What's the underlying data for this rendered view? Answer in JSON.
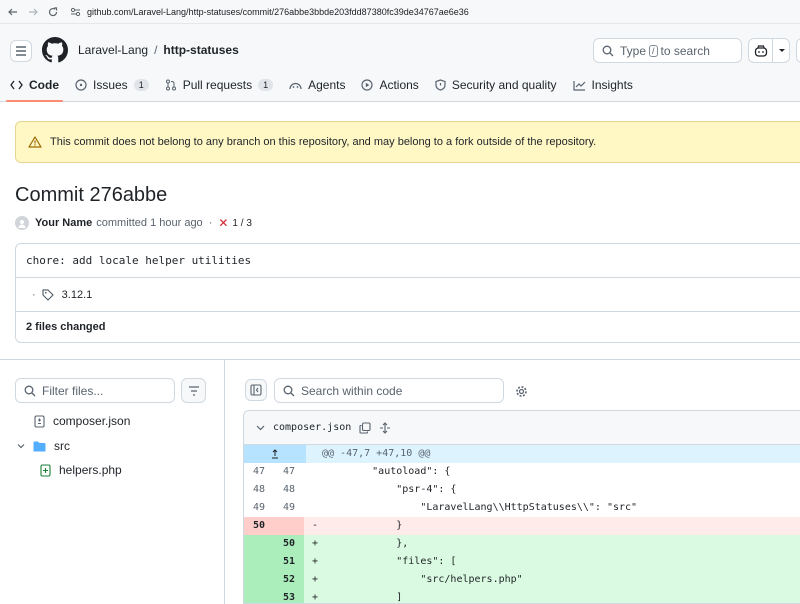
{
  "browser": {
    "url": "github.com/Laravel-Lang/http-statuses/commit/276abbe3bbde203fdd87380fc39de34767ae6e36"
  },
  "header": {
    "owner": "Laravel-Lang",
    "separator": "/",
    "repo": "http-statuses",
    "search_prefix": "Type",
    "search_key": "/",
    "search_suffix": "to search"
  },
  "tabs": [
    {
      "label": "Code",
      "count": "",
      "icon": "code-icon",
      "active": true
    },
    {
      "label": "Issues",
      "count": "1",
      "icon": "issue-icon",
      "active": false
    },
    {
      "label": "Pull requests",
      "count": "1",
      "icon": "pull-request-icon",
      "active": false
    },
    {
      "label": "Agents",
      "count": "",
      "icon": "agents-icon",
      "active": false
    },
    {
      "label": "Actions",
      "count": "",
      "icon": "actions-icon",
      "active": false
    },
    {
      "label": "Security and quality",
      "count": "",
      "icon": "shield-icon",
      "active": false
    },
    {
      "label": "Insights",
      "count": "",
      "icon": "graph-icon",
      "active": false
    }
  ],
  "flash": {
    "message": "This commit does not belong to any branch on this repository, and may belong to a fork outside of the repository."
  },
  "commit": {
    "title": "Commit 276abbe",
    "author": "Your Name",
    "action": "committed",
    "time": "1 hour ago",
    "dot": "·",
    "status_mark": "✕",
    "checks": "1 / 3",
    "message": "chore: add locale helper utilities",
    "tag_dot": "·",
    "tag": "3.12.1",
    "files_changed": "2 files changed"
  },
  "file_tree": {
    "filter_placeholder": "Filter files...",
    "items": [
      {
        "label": "composer.json",
        "type": "file-modified"
      },
      {
        "label": "src",
        "type": "folder"
      },
      {
        "label": "helpers.php",
        "type": "file-added"
      }
    ]
  },
  "diff": {
    "search_placeholder": "Search within code",
    "filename": "composer.json",
    "hunk": "@@ -47,7 +47,10 @@",
    "rows": [
      {
        "kind": "ctx",
        "old": "47",
        "new": "47",
        "sign": "",
        "code": "        \"autoload\": {"
      },
      {
        "kind": "ctx",
        "old": "48",
        "new": "48",
        "sign": "",
        "code": "            \"psr-4\": {"
      },
      {
        "kind": "ctx",
        "old": "49",
        "new": "49",
        "sign": "",
        "code": "                \"LaravelLang\\\\HttpStatuses\\\\\": \"src\""
      },
      {
        "kind": "del",
        "old": "50",
        "new": "",
        "sign": "-",
        "code": "            }"
      },
      {
        "kind": "add",
        "old": "",
        "new": "50",
        "sign": "+",
        "code": "            },"
      },
      {
        "kind": "add",
        "old": "",
        "new": "51",
        "sign": "+",
        "code": "            \"files\": ["
      },
      {
        "kind": "add",
        "old": "",
        "new": "52",
        "sign": "+",
        "code": "                \"src/helpers.php\""
      },
      {
        "kind": "add",
        "old": "",
        "new": "53",
        "sign": "+",
        "code": "            ]"
      }
    ]
  },
  "colors": {
    "accent_tab": "#fd8c73",
    "warning_bg": "#fff8c5",
    "deletion_bg": "#ffebe9",
    "addition_bg": "#dafbe1",
    "hunk_bg": "#ddf4ff",
    "folder": "#54aeff",
    "added_icon": "#1a7f37",
    "error": "#d1242f"
  }
}
